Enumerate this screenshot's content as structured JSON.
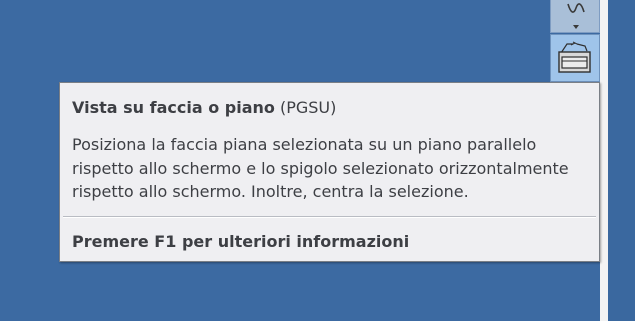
{
  "tooltip": {
    "title": "Vista su faccia o piano",
    "command": "(PGSU)",
    "description": "Posiziona la faccia piana selezionata su un piano parallelo rispetto allo schermo e lo spigolo selezionato orizzontalmente rispetto allo schermo. Inoltre, centra la selezione.",
    "help": "Premere F1 per ulteriori informazioni"
  },
  "toolbar": {
    "buttons": [
      {
        "icon": "wave-dropdown-icon",
        "state": "normal"
      },
      {
        "icon": "face-plane-view-icon",
        "state": "active"
      }
    ]
  },
  "colors": {
    "viewport_background": "#3c6aa2",
    "tooltip_background": "#efeff2",
    "active_button": "#9fc4ea"
  }
}
